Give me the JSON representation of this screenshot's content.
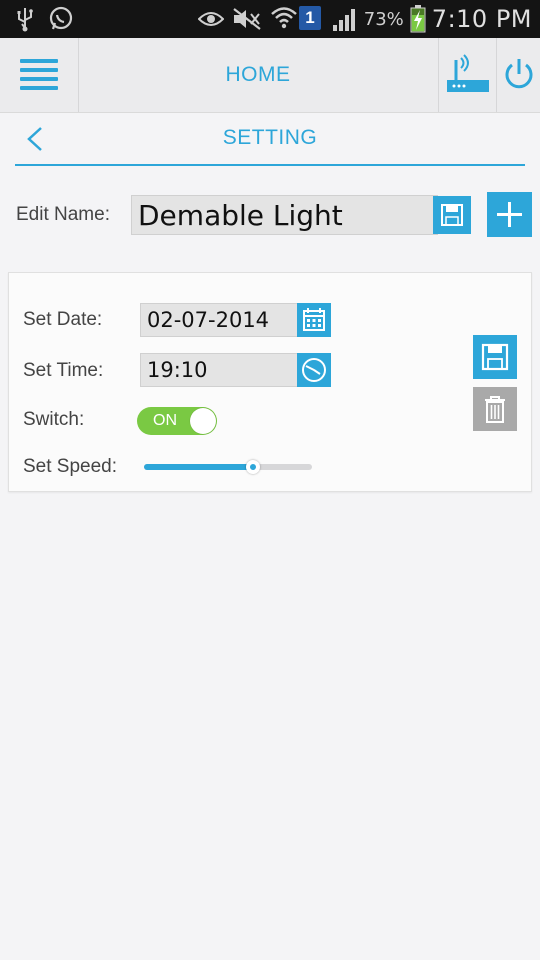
{
  "status_bar": {
    "icons": [
      "usb-icon",
      "whatsapp-icon",
      "eye-icon",
      "mute-icon",
      "wifi-icon",
      "notification-badge",
      "signal-icon",
      "battery-icon"
    ],
    "notification_count": "1",
    "battery_percent": "73%",
    "time": "7:10 PM"
  },
  "app_bar": {
    "title": "HOME",
    "icons": [
      "menu-icon",
      "router-icon",
      "power-icon"
    ]
  },
  "sub_header": {
    "title": "SETTING"
  },
  "edit_name": {
    "label": "Edit Name:",
    "value": "Demable Light"
  },
  "schedule": {
    "date_label": "Set Date:",
    "date_value": "02-07-2014",
    "time_label": "Set Time:",
    "time_value": "19:10",
    "switch_label": "Switch:",
    "switch_state": "ON",
    "speed_label": "Set Speed:",
    "speed_value": 0.65
  },
  "colors": {
    "accent": "#2da6d9",
    "toggle_on": "#7ac943",
    "delete_gray": "#a9a9a9",
    "status_bar": "#141414"
  }
}
